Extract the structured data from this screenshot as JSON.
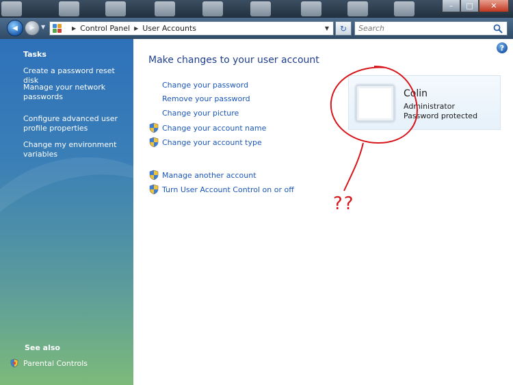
{
  "window": {
    "controls": {
      "minimize": "–",
      "maximize": "□",
      "close": "✕"
    }
  },
  "navigation": {
    "back_glyph": "◀",
    "forward_glyph": "▶",
    "breadcrumb": [
      "Control Panel",
      "User Accounts"
    ],
    "search_placeholder": "Search",
    "refresh_glyph": "↻"
  },
  "sidebar": {
    "tasks_heading": "Tasks",
    "tasks": [
      "Create a password reset disk",
      "Manage your network passwords",
      "Configure advanced user profile properties",
      "Change my environment variables"
    ],
    "see_also_heading": "See also",
    "see_also": [
      "Parental Controls"
    ]
  },
  "main": {
    "help_glyph": "?",
    "title": "Make changes to your user account",
    "tasks": [
      {
        "label": "Change your password",
        "shield": false
      },
      {
        "label": "Remove your password",
        "shield": false
      },
      {
        "label": "Change your picture",
        "shield": false
      },
      {
        "label": "Change your account name",
        "shield": true
      },
      {
        "label": "Change your account type",
        "shield": true
      }
    ],
    "other_tasks": [
      {
        "label": "Manage another account",
        "shield": true
      },
      {
        "label": "Turn User Account Control on or off",
        "shield": true
      }
    ],
    "account": {
      "name": "Colin",
      "role": "Administrator",
      "status": "Password protected"
    },
    "annotation_text": "??"
  },
  "colors": {
    "link": "#1a56b8",
    "title": "#1e3e8c",
    "annotation": "#d8141b"
  },
  "icons": [
    "back-arrow-icon",
    "forward-arrow-icon",
    "control-panel-icon",
    "refresh-icon",
    "search-icon",
    "help-icon",
    "uac-shield-icon",
    "parental-controls-icon"
  ]
}
